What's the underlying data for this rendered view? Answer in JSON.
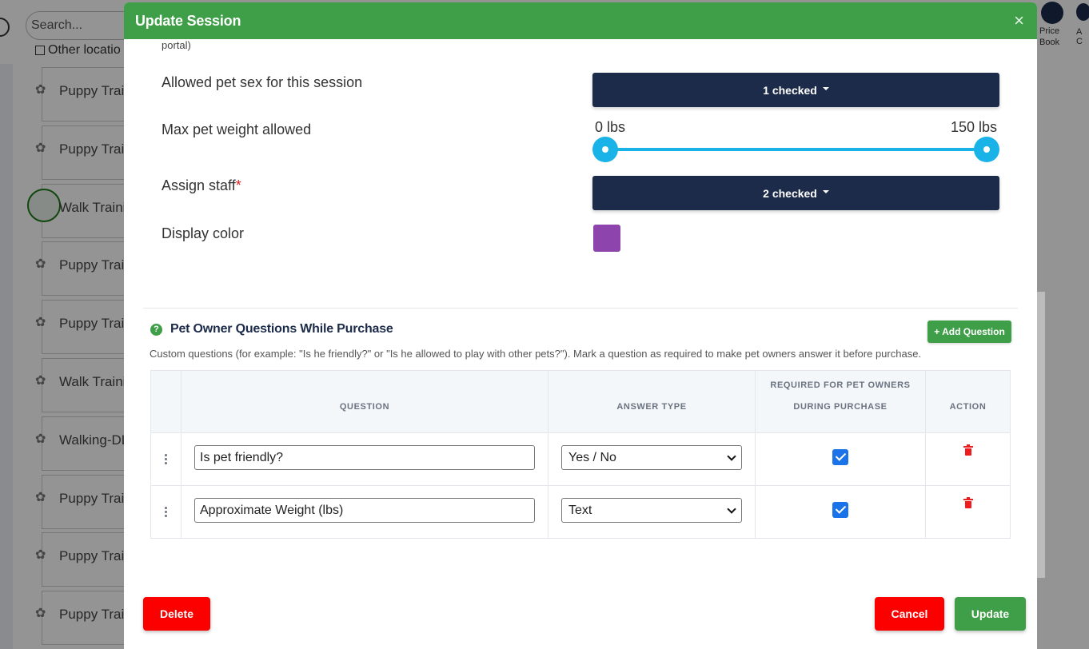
{
  "background": {
    "search_placeholder": "Search...",
    "other_location_label": "Other locatio",
    "list_items": [
      {
        "label": "Puppy Trai",
        "icon": "paw-icon"
      },
      {
        "label": "Puppy Trai",
        "icon": "paw-icon"
      },
      {
        "label": "Walk Traini",
        "icon": "refresh-icon"
      },
      {
        "label": "Puppy Trai",
        "icon": "paw-icon"
      },
      {
        "label": "Puppy Trai",
        "icon": "paw-icon"
      },
      {
        "label": "Walk Traini",
        "icon": "paw-icon"
      },
      {
        "label": "Walking-DL",
        "icon": "paw-icon"
      },
      {
        "label": "Puppy Trai",
        "icon": "paw-icon"
      },
      {
        "label": "Puppy Trai",
        "icon": "paw-icon"
      },
      {
        "label": "Puppy Trai",
        "icon": "paw-icon"
      }
    ],
    "top_right_label_1": "Price",
    "top_right_label_2": "Book",
    "top_right_label_3": "A",
    "top_right_label_4": "C"
  },
  "modal": {
    "title": "Update Session",
    "close_glyph": "×",
    "cut_text": "portal)",
    "fields": {
      "pet_sex_label": "Allowed pet sex for this session",
      "pet_sex_value": "1 checked",
      "max_weight_label": "Max pet weight allowed",
      "weight_min": "0 lbs",
      "weight_max": "150 lbs",
      "staff_label": "Assign staff",
      "staff_required": "*",
      "staff_value": "2 checked",
      "display_color_label": "Display color",
      "display_color": "#8e44ad"
    },
    "questions_section": {
      "help_glyph": "?",
      "title": "Pet Owner Questions While Purchase",
      "add_button": "+ Add Question",
      "description": "Custom questions (for example: \"Is he friendly?\" or \"Is he allowed to play with other pets?\"). Mark a question as required to make pet owners answer it before purchase.",
      "headers": {
        "question": "QUESTION",
        "answer_type": "ANSWER TYPE",
        "required_line1": "REQUIRED FOR PET OWNERS",
        "required_line2": "DURING PURCHASE",
        "action": "ACTION"
      },
      "rows": [
        {
          "question": "Is pet friendly?",
          "answer_type": "Yes / No",
          "required": true
        },
        {
          "question": "Approximate Weight (lbs)",
          "answer_type": "Text",
          "required": true
        }
      ]
    },
    "footer": {
      "delete": "Delete",
      "cancel": "Cancel",
      "update": "Update"
    }
  },
  "colors": {
    "header_green": "#3f9e48",
    "navy": "#1c2b4a",
    "slider_blue": "#1ab3e8",
    "danger_red": "#fc0000",
    "checkbox_blue": "#1a73e8"
  }
}
